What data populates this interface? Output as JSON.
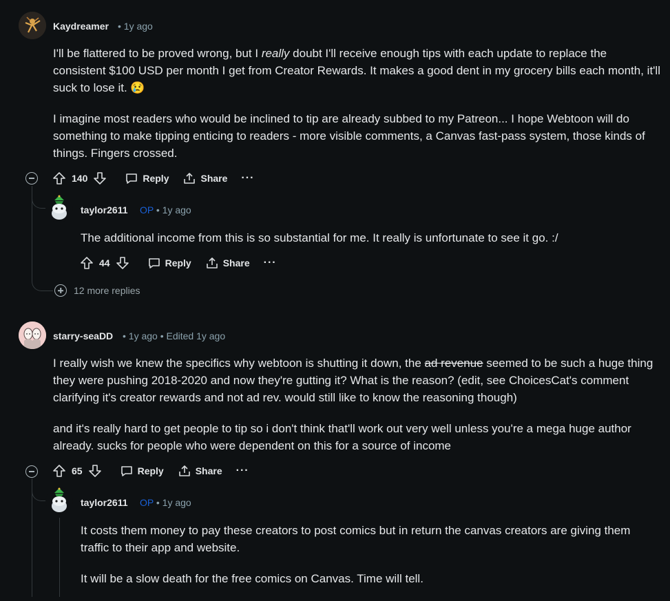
{
  "comments": [
    {
      "username": "Kaydreamer",
      "meta": "• 1y ago",
      "paragraphs": [
        "I'll be flattered to be proved wrong, but I ",
        "really",
        " doubt I'll receive enough tips with each update to replace the consistent $100 USD per month I get from Creator Rewards. It makes a good dent in my grocery bills each month, it'll suck to lose it. 😢",
        "I imagine most readers who would be inclined to tip are already subbed to my Patreon... I hope Webtoon will do something to make tipping enticing to readers - more visible comments, a Canvas fast-pass system, those kinds of things. Fingers crossed."
      ],
      "votes": "140",
      "reply_label": "Reply",
      "share_label": "Share",
      "more_label": "···",
      "reply": {
        "username": "taylor2611",
        "op_label": "OP",
        "meta": "• 1y ago",
        "text": "The additional income from this is so substantial for me. It really is unfortunate to see it go. :/",
        "votes": "44",
        "reply_label": "Reply",
        "share_label": "Share",
        "more_label": "···"
      },
      "more_replies": "12 more replies"
    },
    {
      "username": "starry-seaDD",
      "meta": "• 1y ago • Edited 1y ago",
      "p1_a": "I really wish we knew the specifics why webtoon is shutting it down, the ",
      "p1_strike": "ad revenue",
      "p1_b": " seemed to be such a huge thing they were pushing 2018-2020 and now they're gutting it? What is the reason? (edit, see ChoicesCat's comment clarifying it's creator rewards and not ad rev. would still like to know the reasoning though)",
      "p2": "and it's really hard to get people to tip so i don't think that'll work out very well unless you're a mega huge author already. sucks for people who were dependent on this for a source of income",
      "votes": "65",
      "reply_label": "Reply",
      "share_label": "Share",
      "more_label": "···",
      "reply": {
        "username": "taylor2611",
        "op_label": "OP",
        "meta": "• 1y ago",
        "p1": "It costs them money to pay these creators to post comics but in return the canvas creators are giving them traffic to their app and website.",
        "p2": "It will be a slow death for the free comics on Canvas. Time will tell."
      }
    }
  ]
}
